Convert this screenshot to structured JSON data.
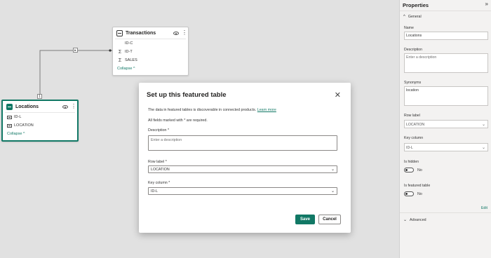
{
  "canvas": {
    "transactions": {
      "title": "Transactions",
      "fields": [
        {
          "icon": "",
          "name": "ID-C"
        },
        {
          "icon": "Σ",
          "name": "ID-T"
        },
        {
          "icon": "Σ",
          "name": "SALES"
        }
      ],
      "collapse_label": "Collapse ^"
    },
    "locations": {
      "title": "Locations",
      "fields": [
        {
          "name": "ID-L"
        },
        {
          "name": "LOCATION"
        }
      ],
      "collapse_label": "Collapse ^"
    },
    "relationship": {
      "one_badge": "1",
      "many_badge": "*",
      "arrow_badge": "▸"
    }
  },
  "dialog": {
    "title": "Set up this featured table",
    "close_glyph": "✕",
    "info_text": "The data in featured tables is discoverable in connected products.",
    "learn_more": "Learn more",
    "required_note": "All fields marked with * are required.",
    "description_label": "Description *",
    "description_placeholder": "Enter a description",
    "row_label_label": "Row label *",
    "row_label_value": "LOCATION",
    "key_column_label": "Key column *",
    "key_column_value": "ID-L",
    "save_label": "Save",
    "cancel_label": "Cancel"
  },
  "properties": {
    "title": "Properties",
    "collapse_glyph": "»",
    "general_label": "General",
    "name_label": "Name",
    "name_value": "Locations",
    "description_label": "Description",
    "description_placeholder": "Enter a description",
    "synonyms_label": "Synonyms",
    "synonyms_value": "location",
    "row_label_label": "Row label",
    "row_label_value": "LOCATION",
    "key_column_label": "Key column",
    "key_column_value": "ID-L",
    "is_hidden_label": "Is hidden",
    "is_hidden_value": "No",
    "is_featured_label": "Is featured table",
    "is_featured_value": "No",
    "edit_label": "Edit",
    "advanced_label": "Advanced"
  },
  "colors": {
    "accent": "#117865",
    "canvas_bg": "#e1e1e1",
    "panel_bg": "#f3f2f1"
  }
}
